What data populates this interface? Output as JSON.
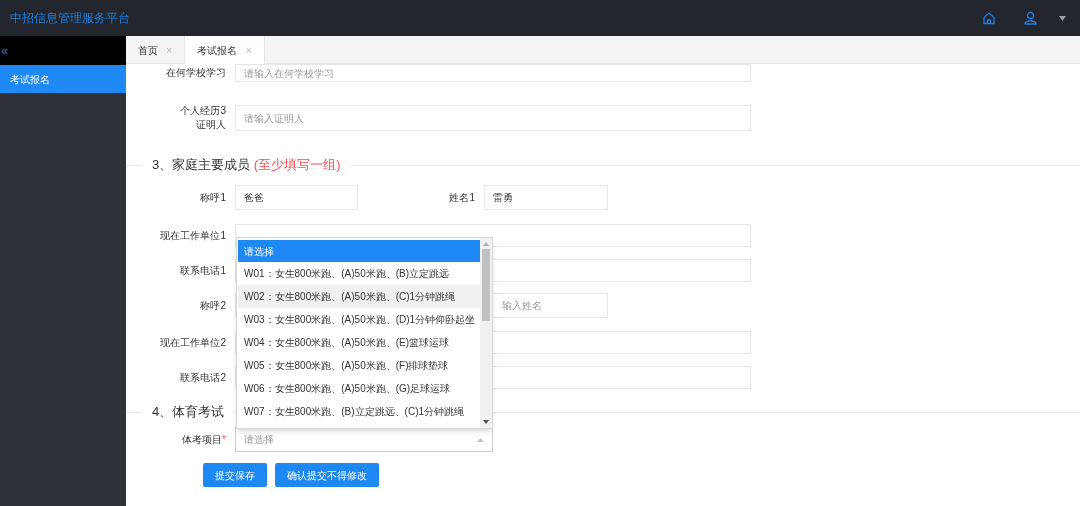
{
  "header": {
    "title": "中招信息管理服务平台"
  },
  "sidebar": {
    "collapse": "«",
    "items": [
      {
        "label": "考试报名",
        "selected": true
      }
    ]
  },
  "tabs": [
    {
      "label": "首页",
      "close": "×",
      "selected": false
    },
    {
      "label": "考试报名",
      "close": "×",
      "selected": true
    }
  ],
  "form": [
    {
      "kind": "field",
      "label": "在何学校学习",
      "placeholder": "请输入在何学校学习"
    },
    {
      "kind": "field",
      "label": "个人经历3证明人",
      "placeholder": "请输入证明人"
    },
    {
      "kind": "heading",
      "title": "3、家庭主要成员",
      "note": "(至少填写一组)"
    },
    {
      "kind": "pair",
      "label": "称呼1",
      "value": "爸爸",
      "label2": "姓名1",
      "value2": "雷勇"
    },
    {
      "kind": "field",
      "label": "现在工作单位1"
    },
    {
      "kind": "field",
      "label": "联系电话1"
    },
    {
      "kind": "pair",
      "label": "称呼2",
      "placeholder2": "输入姓名"
    },
    {
      "kind": "field",
      "label": "现在工作单位2"
    },
    {
      "kind": "field",
      "label": "联系电话2"
    },
    {
      "kind": "heading",
      "title": "4、体育考试"
    },
    {
      "kind": "select",
      "label": "体考项目",
      "required_mark": "*",
      "placeholder": "请选择",
      "expanded": true
    }
  ],
  "dropdown": [
    {
      "label": "请选择",
      "selected": true,
      "hovered": false
    },
    {
      "label": "W01：女生800米跑、(A)50米跑、(B)立定跳远",
      "selected": false,
      "hovered": false
    },
    {
      "label": "W02：女生800米跑、(A)50米跑、(C)1分钟跳绳",
      "selected": false,
      "hovered": true
    },
    {
      "label": "W03：女生800米跑、(A)50米跑、(D)1分钟仰卧起坐",
      "selected": false,
      "hovered": false
    },
    {
      "label": "W04：女生800米跑、(A)50米跑、(E)篮球运球",
      "selected": false,
      "hovered": false
    },
    {
      "label": "W05：女生800米跑、(A)50米跑、(F)排球垫球",
      "selected": false,
      "hovered": false
    },
    {
      "label": "W06：女生800米跑、(A)50米跑、(G)足球运球",
      "selected": false,
      "hovered": false
    },
    {
      "label": "W07：女生800米跑、(B)立定跳远、(C)1分钟跳绳",
      "selected": false,
      "hovered": false
    }
  ],
  "buttons": [
    "提交保存",
    "确认提交不得修改"
  ]
}
